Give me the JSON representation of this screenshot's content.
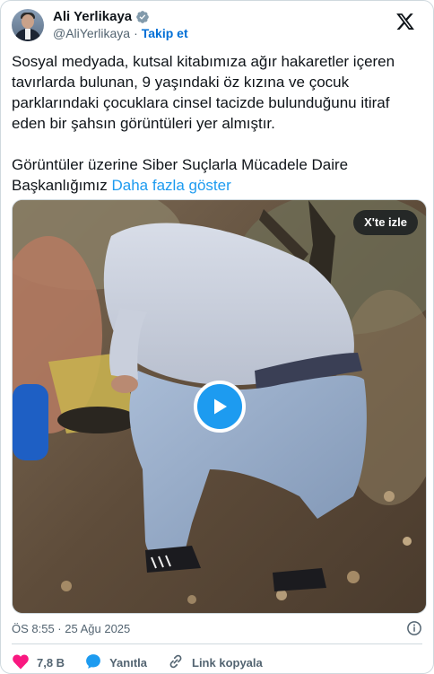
{
  "author": {
    "name": "Ali Yerlikaya",
    "handle": "@AliYerlikaya",
    "follow_label": "Takip et",
    "separator": "·"
  },
  "tweet": {
    "paragraph1": "Sosyal medyada, kutsal kitabımıza ağır hakaretler içeren tavırlarda bulunan, 9 yaşındaki öz kızına ve çocuk parklarındaki çocuklara cinsel tacizde bulunduğunu itiraf eden bir şahsın görüntüleri yer almıştır.",
    "paragraph2": "Görüntüler üzerine Siber Suçlarla Mücadele Daire Başkanlığımız",
    "show_more": "Daha fazla göster"
  },
  "media": {
    "watch_label": "X'te izle",
    "type": "video"
  },
  "timestamp": "ÖS 8:55 · 25 Ağu 2025",
  "actions": {
    "likes": "7,8 B",
    "reply_label": "Yanıtla",
    "copy_link_label": "Link kopyala"
  },
  "colors": {
    "accent": "#1d9bf0",
    "like": "#f91880",
    "muted": "#536471",
    "text": "#0f1419"
  },
  "icons": [
    "verified-badge-icon",
    "x-logo-icon",
    "play-icon",
    "info-icon",
    "heart-icon",
    "reply-icon",
    "link-icon"
  ]
}
